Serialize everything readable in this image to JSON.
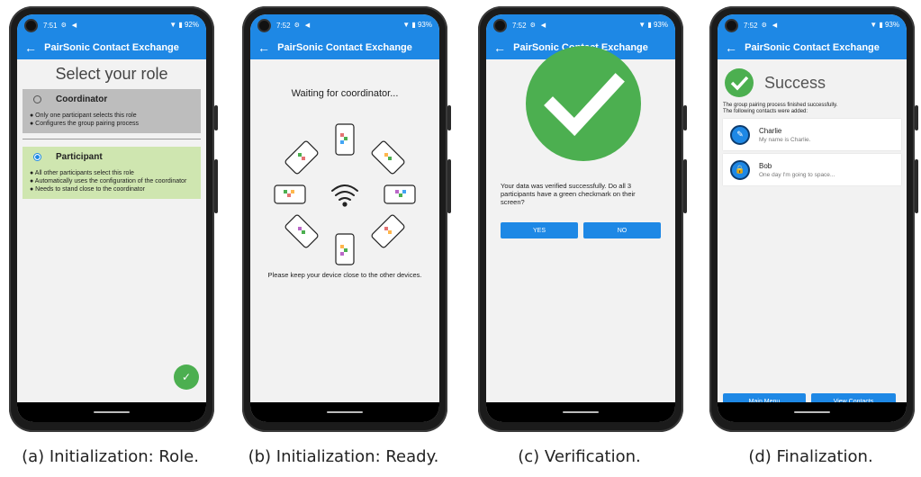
{
  "common": {
    "app_title": "PairSonic Contact Exchange",
    "back_icon": "arrow-left-icon",
    "status_icons": "⚙ ◀"
  },
  "screen_a": {
    "time": "7:51",
    "status_right": "▼ ▮ 92%",
    "title": "Select your role",
    "coordinator": {
      "label": "Coordinator",
      "bullets": [
        "● Only one participant selects this role",
        "● Configures the group pairing process"
      ]
    },
    "participant": {
      "label": "Participant",
      "bullets": [
        "● All other participants select this role",
        "● Automatically uses the configuration of the coordinator",
        "● Needs to stand close to the coordinator"
      ]
    },
    "fab_symbol": "✓",
    "caption": "(a) Initialization: Role."
  },
  "screen_b": {
    "time": "7:52",
    "status_right": "▼ ▮ 93%",
    "waiting": "Waiting for coordinator...",
    "keep": "Please keep your device close to the other devices.",
    "caption": "(b) Initialization: Ready."
  },
  "screen_c": {
    "time": "7:52",
    "status_right": "▼ ▮ 93%",
    "message": "Your data was verified successfully. Do all 3 participants have a green checkmark on their screen?",
    "yes": "YES",
    "no": "NO",
    "caption": "(c) Verification."
  },
  "screen_d": {
    "time": "7:52",
    "status_right": "▼ ▮ 93%",
    "success": "Success",
    "msg1": "The group pairing process finished successfully.",
    "msg2": "The following contacts were added:",
    "contacts": [
      {
        "name": "Charlie",
        "desc": "My name is Charlie.",
        "icon": "pencil-icon"
      },
      {
        "name": "Bob",
        "desc": "One day I'm going to space...",
        "icon": "lock-icon"
      }
    ],
    "main_menu": "Main Menu",
    "view_contacts": "View Contacts",
    "caption": "(d) Finalization."
  },
  "colors": {
    "primary": "#1e88e5",
    "success": "#4caf50",
    "coordinator_bg": "#bdbdbd",
    "participant_bg": "#cfe6b0"
  }
}
